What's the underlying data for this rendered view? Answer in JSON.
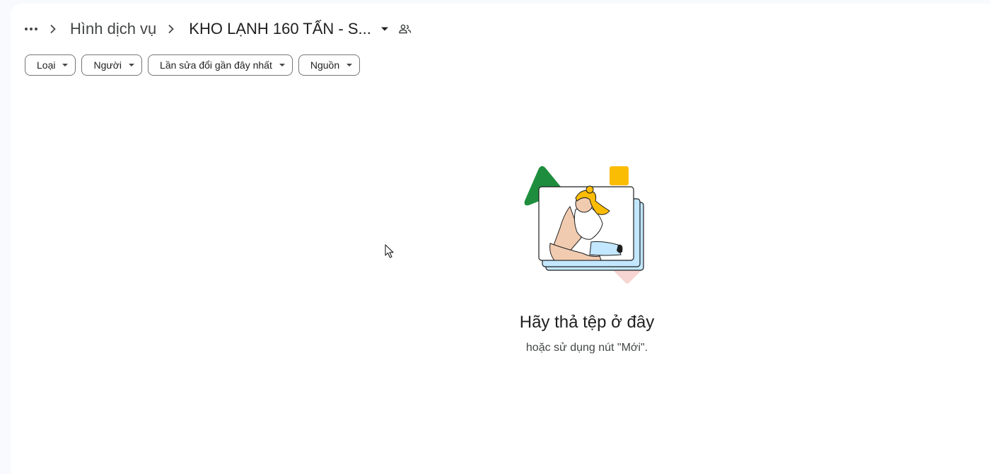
{
  "breadcrumb": {
    "more_icon": "more-horizontal-icon",
    "parent_label": "Hình dịch vụ",
    "current_label": "KHO LẠNH 160 TẤN - S...",
    "shared_icon": "people-icon"
  },
  "filters": [
    {
      "label": "Loại"
    },
    {
      "label": "Người"
    },
    {
      "label": "Lần sửa đổi gần đây nhất"
    },
    {
      "label": "Nguồn"
    }
  ],
  "empty_state": {
    "title": "Hãy thả tệp ở đây",
    "subtitle": "hoặc sử dụng nút \"Mới\"."
  },
  "colors": {
    "accent_green": "#1e8e3e",
    "accent_yellow": "#fbbc04",
    "accent_pink": "#f6d5d2",
    "accent_blue": "#c2e7ff"
  }
}
